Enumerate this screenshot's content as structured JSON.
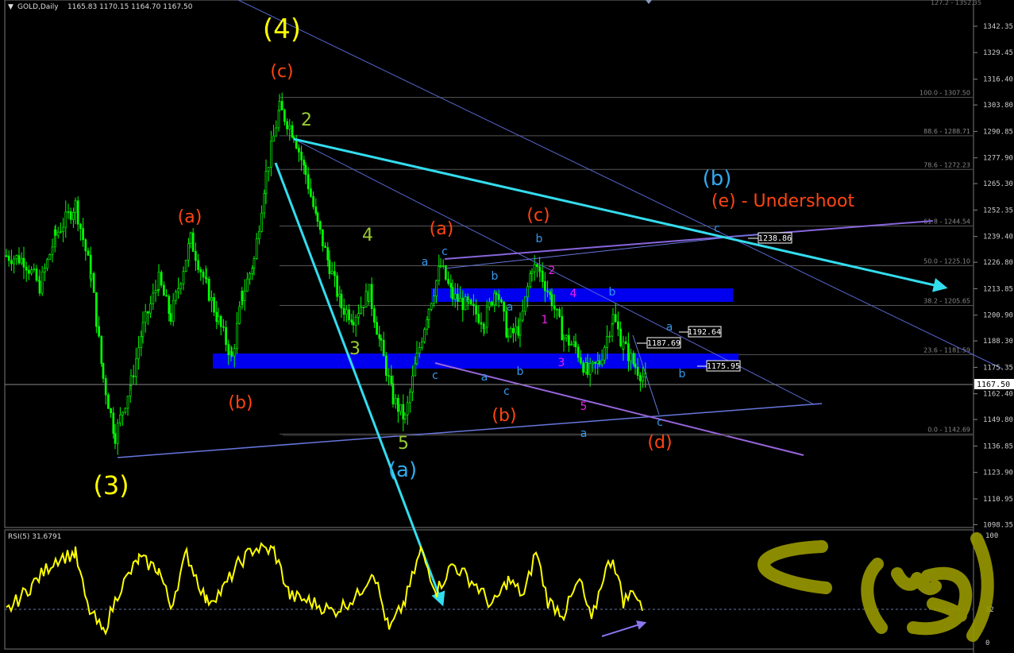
{
  "header": {
    "symbol_tf": "GOLD,Daily",
    "ohlc": "1165.83 1170.15 1164.70 1167.50",
    "arrow": "▼"
  },
  "rsi": {
    "label": "RSI(5) 31.6791",
    "levels": [
      "100",
      "32",
      "0"
    ]
  },
  "colors": {
    "bg": "#000000",
    "candle": "#00ff00",
    "rsi": "#ffff00",
    "box": "#0000ee",
    "cyan": "#33ddee",
    "trend": "#6666cc",
    "purple": "#9966dd"
  },
  "chart_data": {
    "type": "candlestick",
    "symbol": "GOLD",
    "timeframe": "Daily",
    "ylim": [
      1098.35,
      1355.6
    ],
    "y_ticks": [
      "1342.35",
      "1329.45",
      "1316.40",
      "1303.80",
      "1290.85",
      "1277.90",
      "1265.30",
      "1252.35",
      "1239.40",
      "1226.80",
      "1213.85",
      "1200.90",
      "1188.30",
      "1175.35",
      "1162.40",
      "1149.80",
      "1136.85",
      "1123.90",
      "1110.95",
      "1098.35"
    ],
    "last_price": "1167.50",
    "top_cut_label": "127.2 - 1352.35",
    "fib_levels": [
      {
        "label": "100.0 - 1307.50",
        "price": 1307.5
      },
      {
        "label": "88.6 - 1288.71",
        "price": 1288.71
      },
      {
        "label": "78.6 - 1272.23",
        "price": 1272.23
      },
      {
        "label": "61.8 - 1244.54",
        "price": 1244.54
      },
      {
        "label": "50.0 - 1225.10",
        "price": 1225.1
      },
      {
        "label": "38.2 - 1205.65",
        "price": 1205.65
      },
      {
        "label": "23.6 - 1181.59",
        "price": 1181.59
      },
      {
        "label": "0.0 - 1142.69",
        "price": 1142.69
      }
    ],
    "price_boxes": [
      "1238.86",
      "1192.64",
      "1187.69",
      "1175.95"
    ],
    "wave_labels": [
      {
        "text": "(4)",
        "color": "#ffff00"
      },
      {
        "text": "(3)",
        "color": "#ffff00"
      },
      {
        "text": "(c)",
        "color": "#ff4411"
      },
      {
        "text": "(a)",
        "color": "#ff4411"
      },
      {
        "text": "(b)",
        "color": "#ff4411"
      },
      {
        "text": "2",
        "color": "#99cc33"
      },
      {
        "text": "4",
        "color": "#99cc33"
      },
      {
        "text": "3",
        "color": "#99cc33"
      },
      {
        "text": "5",
        "color": "#99cc33"
      },
      {
        "text": "(a)",
        "color": "#33aaee"
      },
      {
        "text": "(a)",
        "color": "#ff4411"
      },
      {
        "text": "(c)",
        "color": "#ff4411"
      },
      {
        "text": "(b)",
        "color": "#ff4411"
      },
      {
        "text": "(d)",
        "color": "#ff4411"
      },
      {
        "text": "(b)",
        "color": "#33aaee"
      },
      {
        "text": "(e) - Undershoot",
        "color": "#ff4411"
      },
      {
        "text": "a",
        "color": "#3399ee"
      },
      {
        "text": "c",
        "color": "#3399ee"
      },
      {
        "text": "b",
        "color": "#3399ee"
      },
      {
        "text": "a",
        "color": "#3399ee"
      },
      {
        "text": "b",
        "color": "#3399ee"
      },
      {
        "text": "a",
        "color": "#3399ee"
      },
      {
        "text": "b",
        "color": "#3399ee"
      },
      {
        "text": "c",
        "color": "#3399ee"
      },
      {
        "text": "c",
        "color": "#3399ee"
      },
      {
        "text": "b",
        "color": "#3399ee"
      },
      {
        "text": "a",
        "color": "#3399ee"
      },
      {
        "text": "a",
        "color": "#3399ee"
      },
      {
        "text": "b",
        "color": "#3399ee"
      },
      {
        "text": "c",
        "color": "#3399ee"
      },
      {
        "text": "c",
        "color": "#3399ee"
      },
      {
        "text": "2",
        "color": "#ee22ee"
      },
      {
        "text": "4",
        "color": "#ee22ee"
      },
      {
        "text": "1",
        "color": "#ee22ee"
      },
      {
        "text": "3",
        "color": "#ee22ee"
      },
      {
        "text": "5",
        "color": "#ee22ee"
      }
    ],
    "rsi_series_name": "RSI(5)",
    "rsi_current": 31.6791,
    "rsi_reference_level": 32
  }
}
